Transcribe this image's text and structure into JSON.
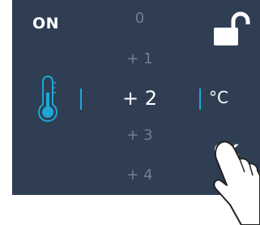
{
  "status": {
    "power_label": "ON"
  },
  "picker": {
    "items": [
      "0",
      "+ 1",
      "+ 2",
      "+ 3",
      "+ 4"
    ],
    "selected": "+ 2"
  },
  "unit_label": "°C",
  "ok_label": "OK",
  "icons": {
    "lock": "unlocked-padlock-icon",
    "thermometer": "thermometer-icon",
    "hand": "pointing-hand-icon"
  },
  "colors": {
    "background": "#2f3e53",
    "accent": "#1ea7d6",
    "text": "#ffffff",
    "dim_text": "#6e7f98"
  }
}
